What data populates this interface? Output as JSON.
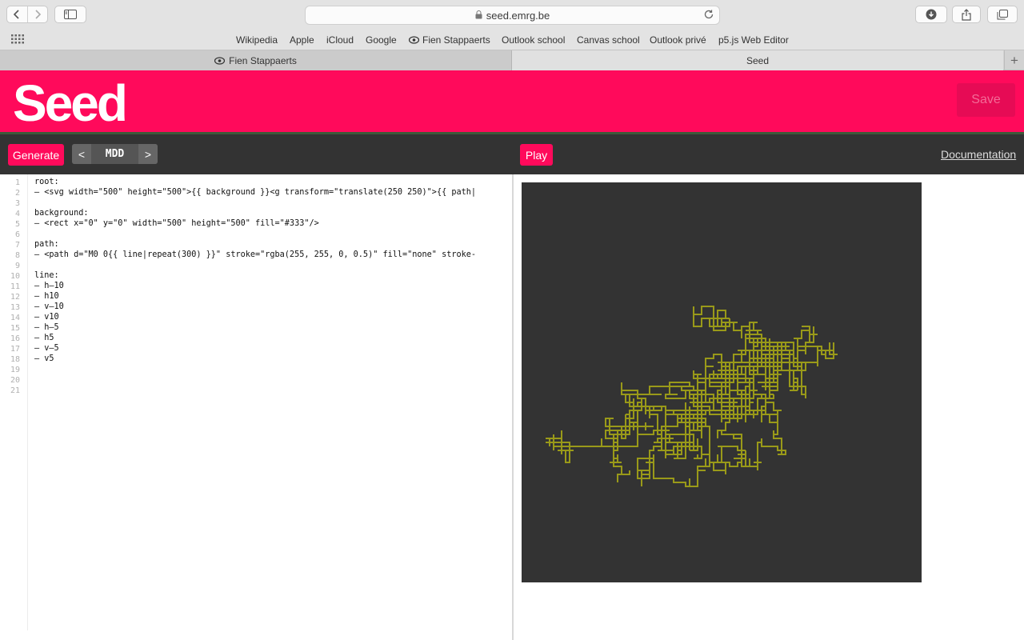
{
  "browser": {
    "url": "seed.emrg.be",
    "bookmarks": [
      "Wikipedia",
      "Apple",
      "iCloud",
      "Google",
      "Fien Stappaerts",
      "Outlook school",
      "Canvas school",
      "Outlook privé",
      "p5.js Web Editor"
    ],
    "tabs": [
      {
        "label": "Fien Stappaerts",
        "active": false
      },
      {
        "label": "Seed",
        "active": true
      }
    ]
  },
  "app": {
    "title": "Seed",
    "save_label": "Save",
    "generate_label": "Generate",
    "seed_code": "MDD",
    "prev_label": "<",
    "next_label": ">",
    "play_label": "Play",
    "documentation_label": "Documentation",
    "accent_color": "#ff0a5b"
  },
  "editor": {
    "line_numbers": [
      "1",
      "2",
      "3",
      "4",
      "5",
      "6",
      "7",
      "8",
      "9",
      "10",
      "11",
      "12",
      "13",
      "14",
      "15",
      "16",
      "17",
      "18",
      "19",
      "20",
      "21"
    ],
    "lines": [
      "root:",
      "– <svg width=\"500\" height=\"500\">{{ background }}<g transform=\"translate(250 250)\">{{ path|",
      "",
      "background:",
      "– <rect x=\"0\" y=\"0\" width=\"500\" height=\"500\" fill=\"#333\"/>",
      "",
      "path:",
      "– <path d=\"M0 0{{ line|repeat(300) }}\" stroke=\"rgba(255, 255, 0, 0.5)\" fill=\"none\" stroke-",
      "",
      "line:",
      "– h–10",
      "– h10",
      "– v–10",
      "– v10",
      "– h–5",
      "– h5",
      "– v–5",
      "– v5",
      "",
      "",
      ""
    ]
  },
  "preview": {
    "background_color": "#333333",
    "stroke_color": "rgba(255, 255, 0, 0.5)",
    "steps": [
      "h-10",
      "h10",
      "v-10",
      "v10",
      "h-5",
      "h5",
      "v-5",
      "v5"
    ],
    "repeat": 300
  }
}
